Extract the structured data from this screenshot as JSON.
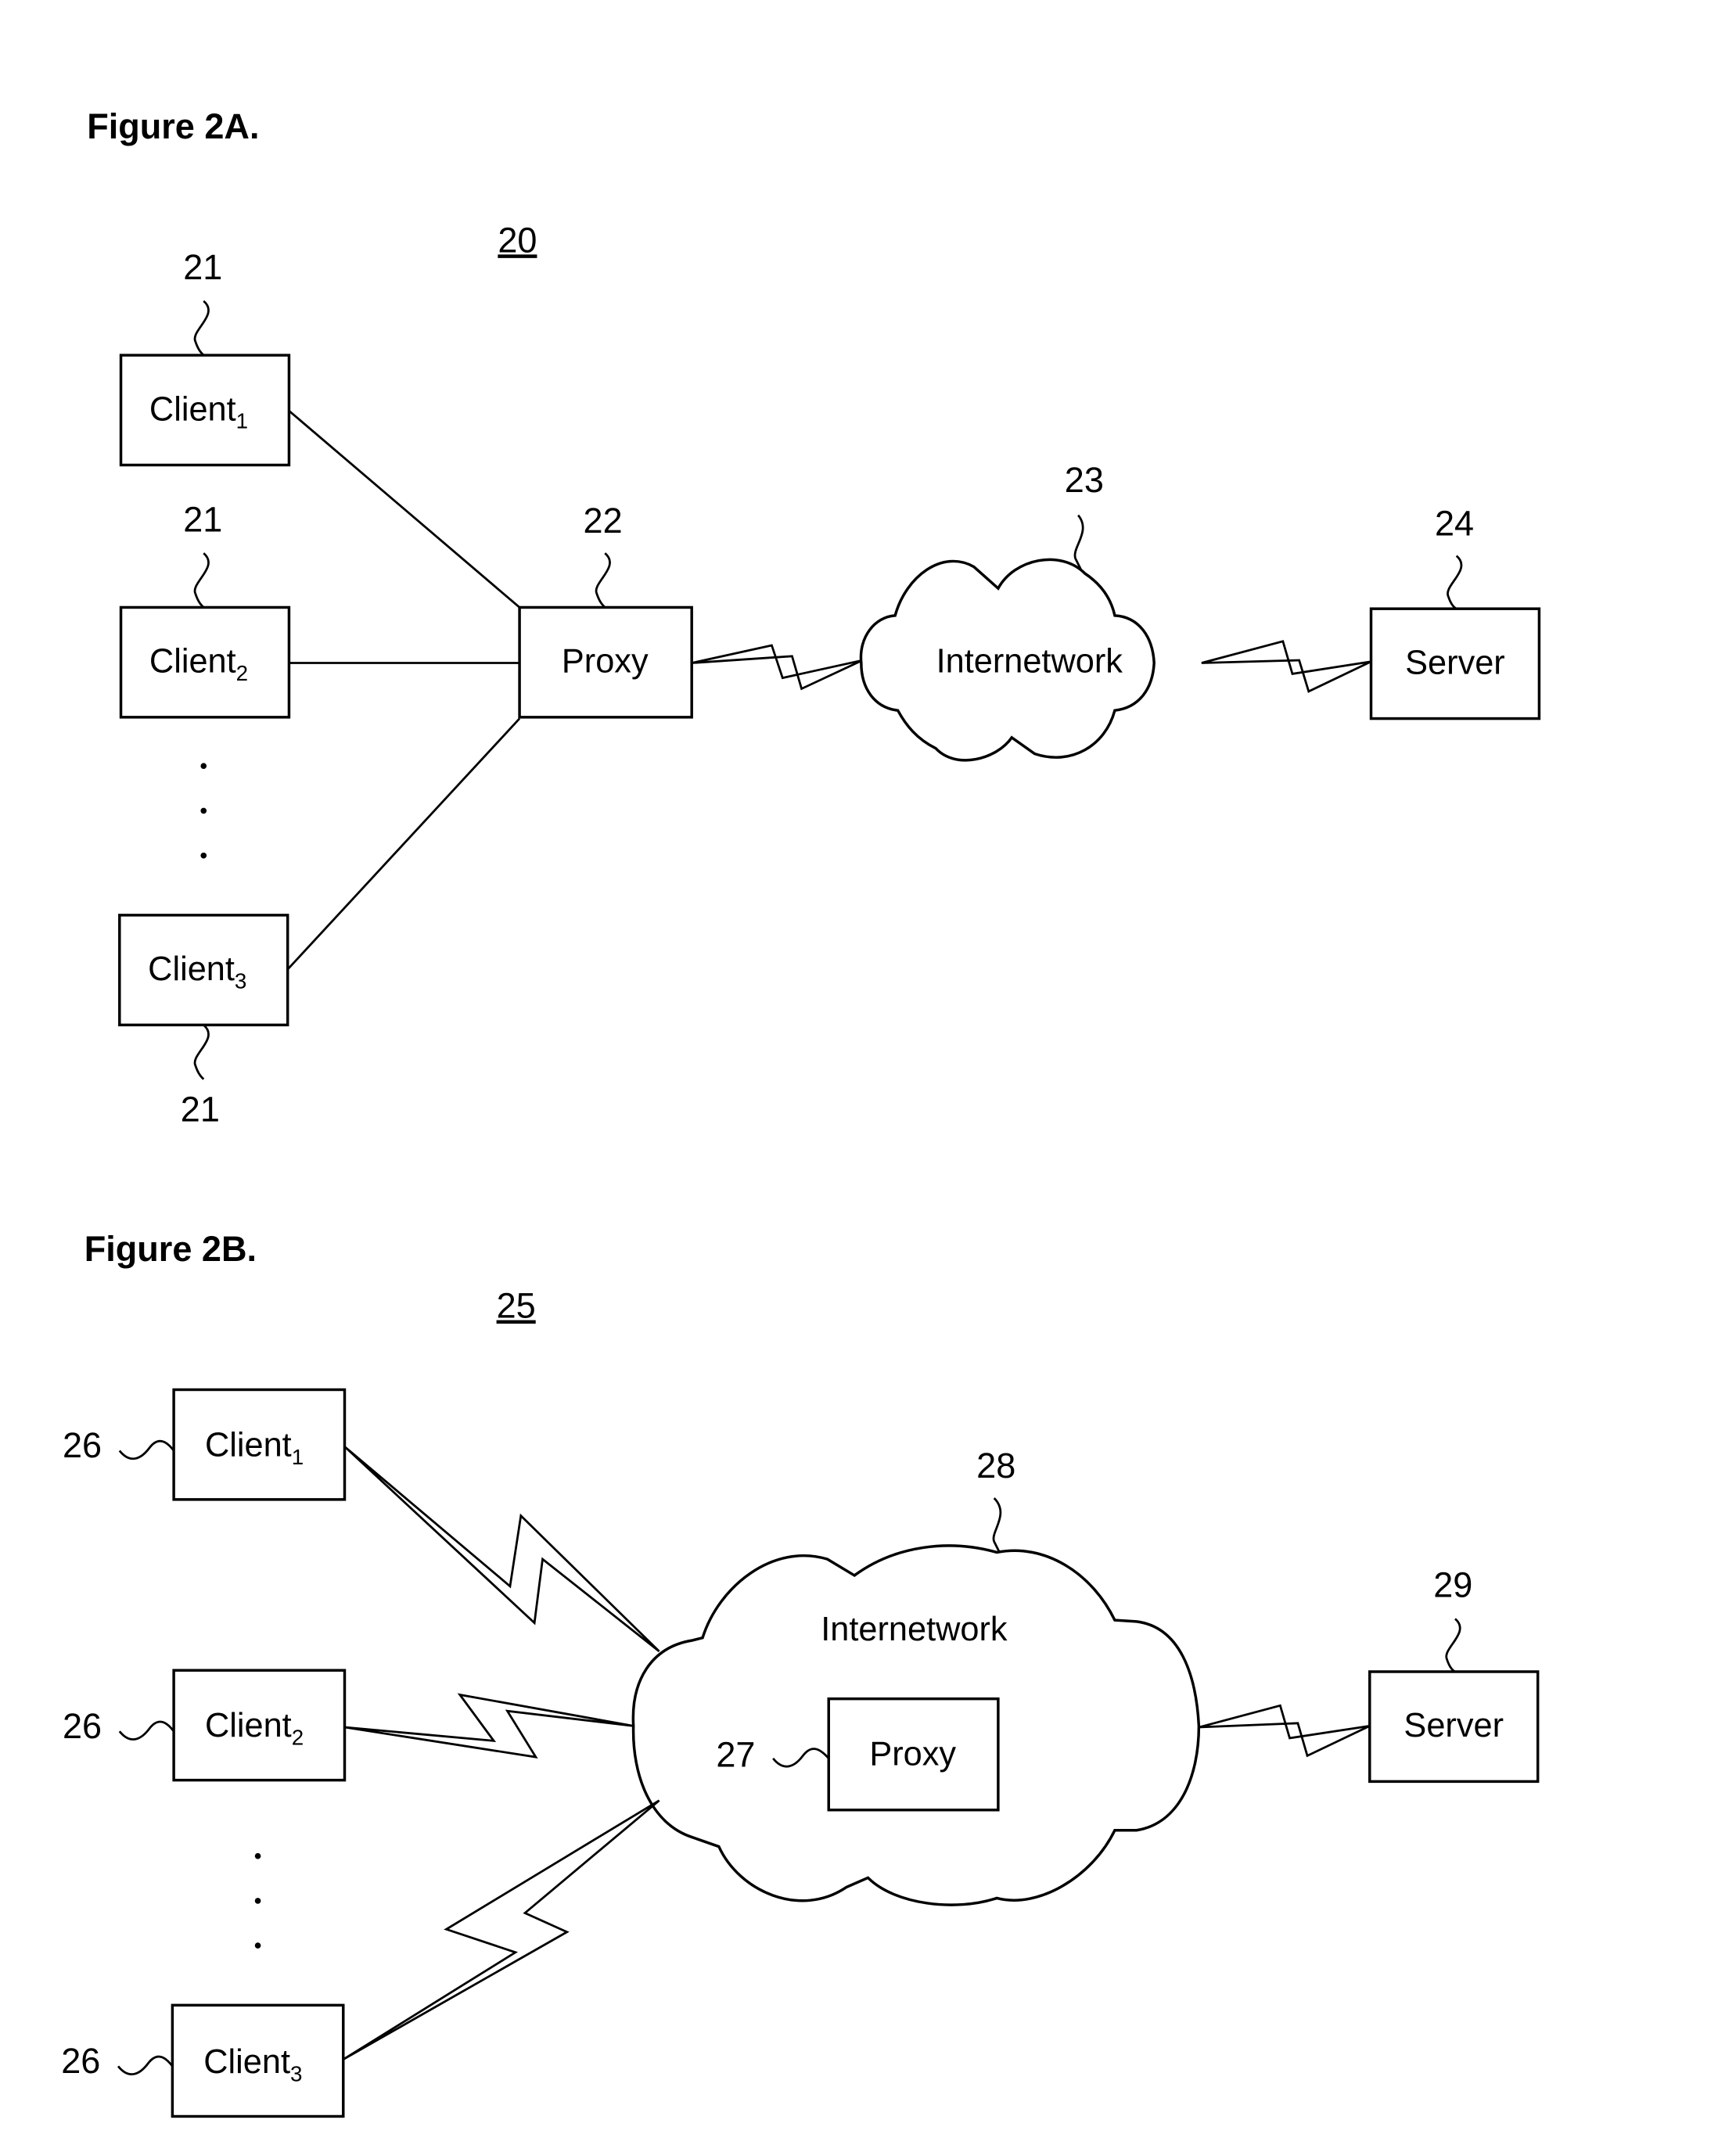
{
  "figure_2a": {
    "title": "Figure 2A.",
    "system_ref": "20",
    "clients": [
      {
        "label": "Client",
        "sub": "1",
        "ref": "21"
      },
      {
        "label": "Client",
        "sub": "2",
        "ref": "21"
      },
      {
        "label": "Client",
        "sub": "3",
        "ref": "21"
      }
    ],
    "ellipsis": "⋮",
    "proxy": {
      "label": "Proxy",
      "ref": "22"
    },
    "network": {
      "label": "Internetwork",
      "ref": "23"
    },
    "server": {
      "label": "Server",
      "ref": "24"
    }
  },
  "figure_2b": {
    "title": "Figure 2B.",
    "system_ref": "25",
    "clients": [
      {
        "label": "Client",
        "sub": "1",
        "ref": "26"
      },
      {
        "label": "Client",
        "sub": "2",
        "ref": "26"
      },
      {
        "label": "Client",
        "sub": "3",
        "ref": "26"
      }
    ],
    "proxy": {
      "label": "Proxy",
      "ref": "27"
    },
    "network": {
      "label": "Internetwork",
      "ref": "28"
    },
    "server": {
      "label": "Server",
      "ref": "29"
    }
  }
}
